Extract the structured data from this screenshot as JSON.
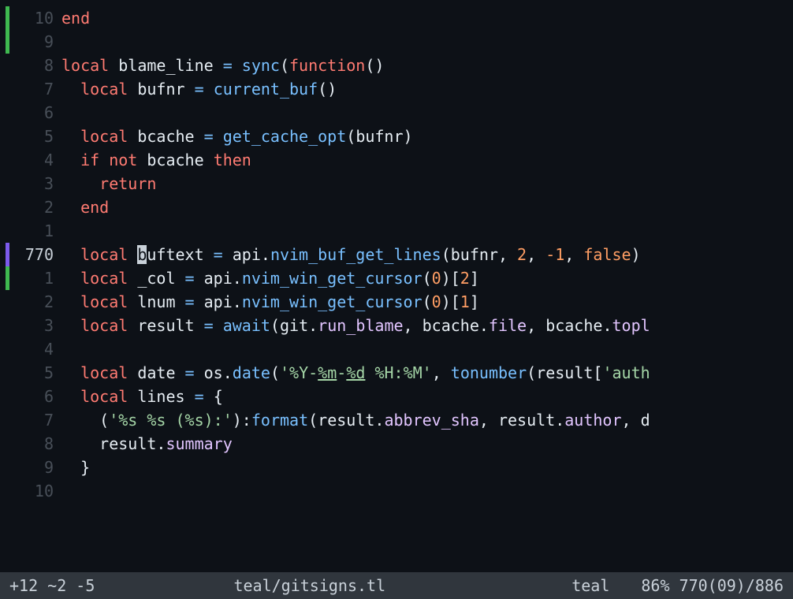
{
  "statusline": {
    "diff": "+12 ~2 -5",
    "filename": "teal/gitsigns.tl",
    "filetype": "teal",
    "position": "86% 770(09)/886"
  },
  "lines": [
    {
      "num": "10",
      "sign": "green",
      "current": false,
      "tokens": [
        {
          "t": "end",
          "c": "kw"
        }
      ]
    },
    {
      "num": "9",
      "sign": "green",
      "current": false,
      "tokens": []
    },
    {
      "num": "8",
      "sign": "",
      "current": false,
      "tokens": [
        {
          "t": "local ",
          "c": "kw"
        },
        {
          "t": "blame_line",
          "c": "id"
        },
        {
          "t": " = ",
          "c": "op"
        },
        {
          "t": "sync",
          "c": "fn"
        },
        {
          "t": "(",
          "c": "pn"
        },
        {
          "t": "function",
          "c": "kw"
        },
        {
          "t": "()",
          "c": "pn"
        }
      ]
    },
    {
      "num": "7",
      "sign": "",
      "current": false,
      "tokens": [
        {
          "t": "  ",
          "c": ""
        },
        {
          "t": "local ",
          "c": "kw"
        },
        {
          "t": "bufnr",
          "c": "id"
        },
        {
          "t": " = ",
          "c": "op"
        },
        {
          "t": "current_buf",
          "c": "fn"
        },
        {
          "t": "()",
          "c": "pn"
        }
      ]
    },
    {
      "num": "6",
      "sign": "",
      "current": false,
      "tokens": []
    },
    {
      "num": "5",
      "sign": "",
      "current": false,
      "tokens": [
        {
          "t": "  ",
          "c": ""
        },
        {
          "t": "local ",
          "c": "kw"
        },
        {
          "t": "bcache",
          "c": "id"
        },
        {
          "t": " = ",
          "c": "op"
        },
        {
          "t": "get_cache_opt",
          "c": "fn"
        },
        {
          "t": "(",
          "c": "pn"
        },
        {
          "t": "bufnr",
          "c": "id"
        },
        {
          "t": ")",
          "c": "pn"
        }
      ]
    },
    {
      "num": "4",
      "sign": "",
      "current": false,
      "tokens": [
        {
          "t": "  ",
          "c": ""
        },
        {
          "t": "if not ",
          "c": "kw"
        },
        {
          "t": "bcache",
          "c": "id"
        },
        {
          "t": " ",
          "c": ""
        },
        {
          "t": "then",
          "c": "kw"
        }
      ]
    },
    {
      "num": "3",
      "sign": "",
      "current": false,
      "tokens": [
        {
          "t": "    ",
          "c": ""
        },
        {
          "t": "return",
          "c": "kw"
        }
      ]
    },
    {
      "num": "2",
      "sign": "",
      "current": false,
      "tokens": [
        {
          "t": "  ",
          "c": ""
        },
        {
          "t": "end",
          "c": "kw"
        }
      ]
    },
    {
      "num": "1",
      "sign": "",
      "current": false,
      "tokens": []
    },
    {
      "num": "770",
      "sign": "purple",
      "current": true,
      "tokens": [
        {
          "t": "  ",
          "c": ""
        },
        {
          "t": "local ",
          "c": "kw"
        },
        {
          "t": "b",
          "c": "cursor"
        },
        {
          "t": "uftext",
          "c": "id"
        },
        {
          "t": " = ",
          "c": "op"
        },
        {
          "t": "api",
          "c": "id"
        },
        {
          "t": ".",
          "c": "pn"
        },
        {
          "t": "nvim_buf_get_lines",
          "c": "fn"
        },
        {
          "t": "(",
          "c": "pn"
        },
        {
          "t": "bufnr",
          "c": "id"
        },
        {
          "t": ", ",
          "c": "pn"
        },
        {
          "t": "2",
          "c": "num"
        },
        {
          "t": ", ",
          "c": "pn"
        },
        {
          "t": "-1",
          "c": "num"
        },
        {
          "t": ", ",
          "c": "pn"
        },
        {
          "t": "false",
          "c": "bool"
        },
        {
          "t": ")",
          "c": "pn"
        }
      ]
    },
    {
      "num": "1",
      "sign": "green",
      "current": false,
      "tokens": [
        {
          "t": "  ",
          "c": ""
        },
        {
          "t": "local ",
          "c": "kw"
        },
        {
          "t": "_col",
          "c": "id"
        },
        {
          "t": " = ",
          "c": "op"
        },
        {
          "t": "api",
          "c": "id"
        },
        {
          "t": ".",
          "c": "pn"
        },
        {
          "t": "nvim_win_get_cursor",
          "c": "fn"
        },
        {
          "t": "(",
          "c": "pn"
        },
        {
          "t": "0",
          "c": "num"
        },
        {
          "t": ")[",
          "c": "pn"
        },
        {
          "t": "2",
          "c": "num"
        },
        {
          "t": "]",
          "c": "pn"
        }
      ]
    },
    {
      "num": "2",
      "sign": "",
      "current": false,
      "tokens": [
        {
          "t": "  ",
          "c": ""
        },
        {
          "t": "local ",
          "c": "kw"
        },
        {
          "t": "lnum",
          "c": "id"
        },
        {
          "t": " = ",
          "c": "op"
        },
        {
          "t": "api",
          "c": "id"
        },
        {
          "t": ".",
          "c": "pn"
        },
        {
          "t": "nvim_win_get_cursor",
          "c": "fn"
        },
        {
          "t": "(",
          "c": "pn"
        },
        {
          "t": "0",
          "c": "num"
        },
        {
          "t": ")[",
          "c": "pn"
        },
        {
          "t": "1",
          "c": "num"
        },
        {
          "t": "]",
          "c": "pn"
        }
      ]
    },
    {
      "num": "3",
      "sign": "",
      "current": false,
      "tokens": [
        {
          "t": "  ",
          "c": ""
        },
        {
          "t": "local ",
          "c": "kw"
        },
        {
          "t": "result",
          "c": "id"
        },
        {
          "t": " = ",
          "c": "op"
        },
        {
          "t": "await",
          "c": "fn"
        },
        {
          "t": "(",
          "c": "pn"
        },
        {
          "t": "git",
          "c": "id"
        },
        {
          "t": ".",
          "c": "pn"
        },
        {
          "t": "run_blame",
          "c": "prop"
        },
        {
          "t": ", ",
          "c": "pn"
        },
        {
          "t": "bcache",
          "c": "id"
        },
        {
          "t": ".",
          "c": "pn"
        },
        {
          "t": "file",
          "c": "prop"
        },
        {
          "t": ", ",
          "c": "pn"
        },
        {
          "t": "bcache",
          "c": "id"
        },
        {
          "t": ".",
          "c": "pn"
        },
        {
          "t": "topl",
          "c": "prop"
        }
      ]
    },
    {
      "num": "4",
      "sign": "",
      "current": false,
      "tokens": []
    },
    {
      "num": "5",
      "sign": "",
      "current": false,
      "tokens": [
        {
          "t": "  ",
          "c": ""
        },
        {
          "t": "local ",
          "c": "kw"
        },
        {
          "t": "date",
          "c": "id"
        },
        {
          "t": " = ",
          "c": "op"
        },
        {
          "t": "os",
          "c": "id"
        },
        {
          "t": ".",
          "c": "pn"
        },
        {
          "t": "date",
          "c": "fn"
        },
        {
          "t": "(",
          "c": "pn"
        },
        {
          "t": "'%Y-",
          "c": "str"
        },
        {
          "t": "%m",
          "c": "str underline"
        },
        {
          "t": "-",
          "c": "str"
        },
        {
          "t": "%d",
          "c": "str underline"
        },
        {
          "t": " %H:%M'",
          "c": "str"
        },
        {
          "t": ", ",
          "c": "pn"
        },
        {
          "t": "tonumber",
          "c": "fn"
        },
        {
          "t": "(",
          "c": "pn"
        },
        {
          "t": "result",
          "c": "id"
        },
        {
          "t": "[",
          "c": "pn"
        },
        {
          "t": "'auth",
          "c": "str"
        }
      ]
    },
    {
      "num": "6",
      "sign": "",
      "current": false,
      "tokens": [
        {
          "t": "  ",
          "c": ""
        },
        {
          "t": "local ",
          "c": "kw"
        },
        {
          "t": "lines",
          "c": "id"
        },
        {
          "t": " = ",
          "c": "op"
        },
        {
          "t": "{",
          "c": "pn"
        }
      ]
    },
    {
      "num": "7",
      "sign": "",
      "current": false,
      "tokens": [
        {
          "t": "    (",
          "c": "pn"
        },
        {
          "t": "'%s %s (%s):'",
          "c": "str"
        },
        {
          "t": "):",
          "c": "pn"
        },
        {
          "t": "format",
          "c": "fn"
        },
        {
          "t": "(",
          "c": "pn"
        },
        {
          "t": "result",
          "c": "id"
        },
        {
          "t": ".",
          "c": "pn"
        },
        {
          "t": "abbrev_sha",
          "c": "prop"
        },
        {
          "t": ", ",
          "c": "pn"
        },
        {
          "t": "result",
          "c": "id"
        },
        {
          "t": ".",
          "c": "pn"
        },
        {
          "t": "author",
          "c": "prop"
        },
        {
          "t": ", ",
          "c": "pn"
        },
        {
          "t": "d",
          "c": "id"
        }
      ]
    },
    {
      "num": "8",
      "sign": "",
      "current": false,
      "tokens": [
        {
          "t": "    ",
          "c": ""
        },
        {
          "t": "result",
          "c": "id"
        },
        {
          "t": ".",
          "c": "pn"
        },
        {
          "t": "summary",
          "c": "prop"
        }
      ]
    },
    {
      "num": "9",
      "sign": "",
      "current": false,
      "tokens": [
        {
          "t": "  }",
          "c": "pn"
        }
      ]
    },
    {
      "num": "10",
      "sign": "",
      "current": false,
      "tokens": []
    }
  ]
}
